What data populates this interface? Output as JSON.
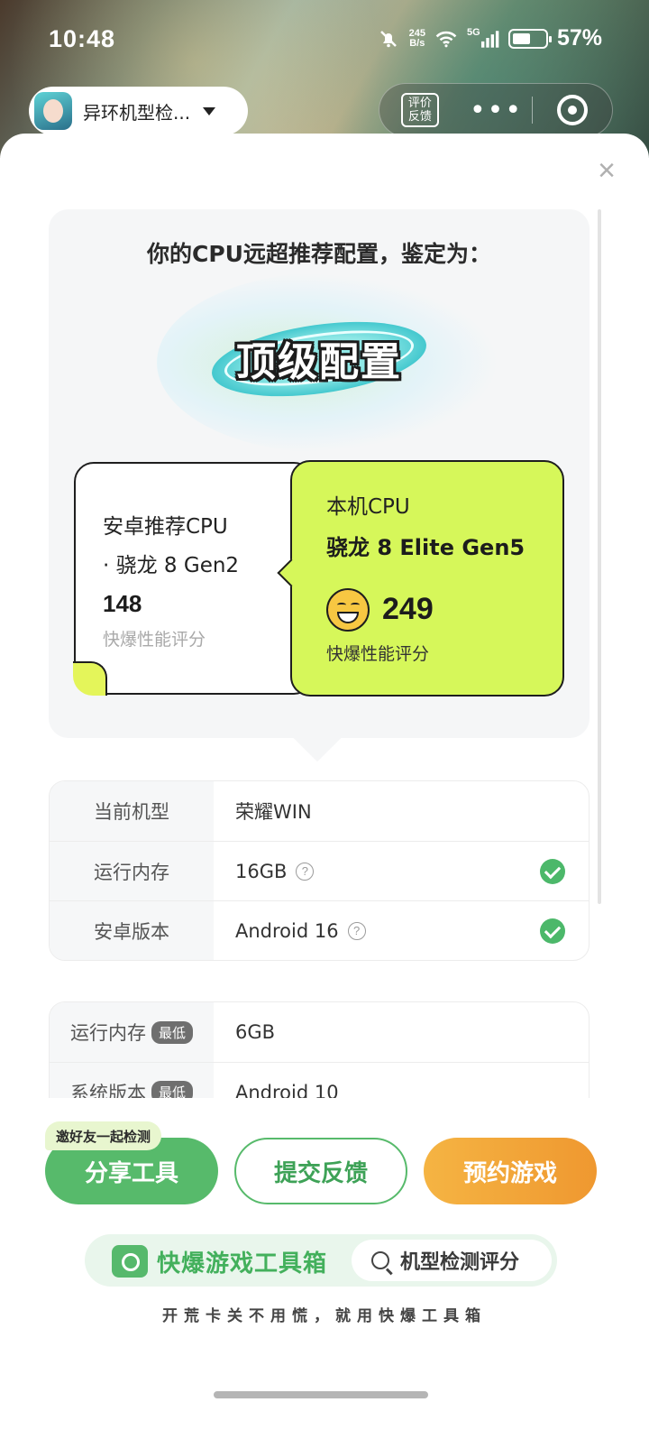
{
  "status_bar": {
    "time": "10:48",
    "net_speed_top": "245",
    "net_speed_unit": "B/s",
    "signal_label": "5G",
    "battery_level": 0.57,
    "battery_percent": "57%"
  },
  "app_header": {
    "app_name": "异环机型检...",
    "review_label_line1": "评价",
    "review_label_line2": "反馈",
    "more_label": "•••"
  },
  "result": {
    "headline": "你的CPU远超推荐配置，鉴定为：",
    "grade": "顶级配置",
    "recommended": {
      "title": "安卓推荐CPU",
      "model": "· 骁龙 8 Gen2",
      "score": "148",
      "score_label": "快爆性能评分"
    },
    "device": {
      "title": "本机CPU",
      "model": "骁龙 8 Elite Gen5",
      "score": "249",
      "score_label": "快爆性能评分"
    }
  },
  "device_specs": [
    {
      "key": "当前机型",
      "value": "荣耀WIN",
      "help": false,
      "ok": false
    },
    {
      "key": "运行内存",
      "value": "16GB",
      "help": true,
      "ok": true
    },
    {
      "key": "安卓版本",
      "value": "Android 16",
      "help": true,
      "ok": true
    }
  ],
  "min_specs": {
    "tag": "最低",
    "rows": [
      {
        "key": "运行内存",
        "value": "6GB"
      },
      {
        "key": "系统版本",
        "value": "Android 10"
      }
    ]
  },
  "actions": {
    "invite_tag": "邀好友一起检测",
    "share": "分享工具",
    "feedback": "提交反馈",
    "reserve": "预约游戏"
  },
  "toolbox": {
    "brand": "快爆游戏工具箱",
    "search_text": "机型检测评分",
    "slogan": "开荒卡关不用慌，就用快爆工具箱"
  },
  "colors": {
    "accent_green": "#57ba6b",
    "lime_card": "#d6f75a",
    "orange": "#ef9830",
    "check_green": "#4cb86a"
  },
  "icons": [
    "mute-bell-icon",
    "wifi-icon",
    "signal-icon",
    "battery-icon",
    "chevron-down-icon",
    "review-icon",
    "more-icon",
    "close-capsule-icon",
    "close-icon",
    "help-icon",
    "check-icon",
    "grin-emoji-icon",
    "toolbox-camera-icon",
    "search-icon"
  ]
}
